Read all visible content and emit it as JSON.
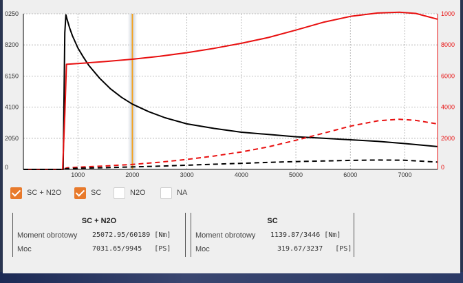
{
  "chart_data": {
    "type": "line",
    "x_ticks": [
      1000,
      2000,
      3000,
      4000,
      5000,
      6000,
      7000
    ],
    "y_left_ticks": [
      "0",
      "2050",
      "4100",
      "6150",
      "8200",
      "0250"
    ],
    "y_right_ticks": [
      "0",
      "2000",
      "4000",
      "6000",
      "8000",
      "1000"
    ],
    "xlim": [
      0,
      7600
    ],
    "ylim_left": [
      0,
      10250
    ],
    "ylim_right": [
      0,
      10000
    ],
    "marker_x": 2000,
    "grid": true,
    "series": [
      {
        "color": "#000000",
        "dash": false,
        "axis": "left",
        "x": [
          0,
          730,
          760,
          780,
          800,
          850,
          900,
          1000,
          1100,
          1200,
          1400,
          1600,
          1800,
          2000,
          2300,
          2600,
          3000,
          3500,
          4000,
          4500,
          5000,
          5500,
          6000,
          6500,
          7000,
          7600
        ],
        "y": [
          0,
          0,
          9000,
          10180,
          9900,
          9300,
          8800,
          8000,
          7400,
          6850,
          6000,
          5300,
          4750,
          4300,
          3800,
          3400,
          3000,
          2700,
          2450,
          2300,
          2150,
          2050,
          1950,
          1850,
          1700,
          1500
        ]
      },
      {
        "color": "#e81010",
        "dash": false,
        "axis": "right",
        "x": [
          0,
          720,
          760,
          790,
          1000,
          1500,
          2000,
          2500,
          3000,
          3500,
          4000,
          4500,
          5000,
          5500,
          6000,
          6500,
          6900,
          7200,
          7600
        ],
        "y": [
          0,
          0,
          3500,
          6750,
          6800,
          6930,
          7080,
          7270,
          7500,
          7780,
          8100,
          8480,
          8950,
          9450,
          9830,
          10050,
          10100,
          10020,
          9650
        ]
      },
      {
        "color": "#e81010",
        "dash": true,
        "axis": "right",
        "x": [
          0,
          720,
          800,
          1000,
          1500,
          2000,
          2500,
          3000,
          3500,
          4000,
          4500,
          5000,
          5500,
          6000,
          6500,
          6900,
          7200,
          7600
        ],
        "y": [
          0,
          0,
          100,
          140,
          220,
          320,
          460,
          640,
          860,
          1120,
          1450,
          1870,
          2320,
          2780,
          3120,
          3220,
          3150,
          2920
        ]
      },
      {
        "color": "#000000",
        "dash": true,
        "axis": "right",
        "x": [
          0,
          720,
          800,
          1000,
          1500,
          2000,
          2500,
          3000,
          3500,
          4000,
          4500,
          5000,
          5500,
          6000,
          6500,
          7000,
          7600
        ],
        "y": [
          0,
          0,
          50,
          70,
          110,
          160,
          210,
          270,
          330,
          390,
          450,
          500,
          540,
          580,
          600,
          590,
          470
        ]
      }
    ]
  },
  "legend": [
    {
      "label": "SC + N2O",
      "checked": true
    },
    {
      "label": "SC",
      "checked": true
    },
    {
      "label": "N2O",
      "checked": false
    },
    {
      "label": "NA",
      "checked": false
    }
  ],
  "boxes": [
    {
      "title": "SC + N2O",
      "rows": [
        {
          "label": "Moment obrotowy",
          "value": "25072.95/60189 [Nm]"
        },
        {
          "label": "Moc",
          "value": "7031.65/9945   [PS]"
        }
      ]
    },
    {
      "title": "SC",
      "rows": [
        {
          "label": "Moment obrotowy",
          "value": "1139.87/3446 [Nm]"
        },
        {
          "label": "Moc",
          "value": "319.67/3237   [PS]"
        }
      ]
    }
  ]
}
